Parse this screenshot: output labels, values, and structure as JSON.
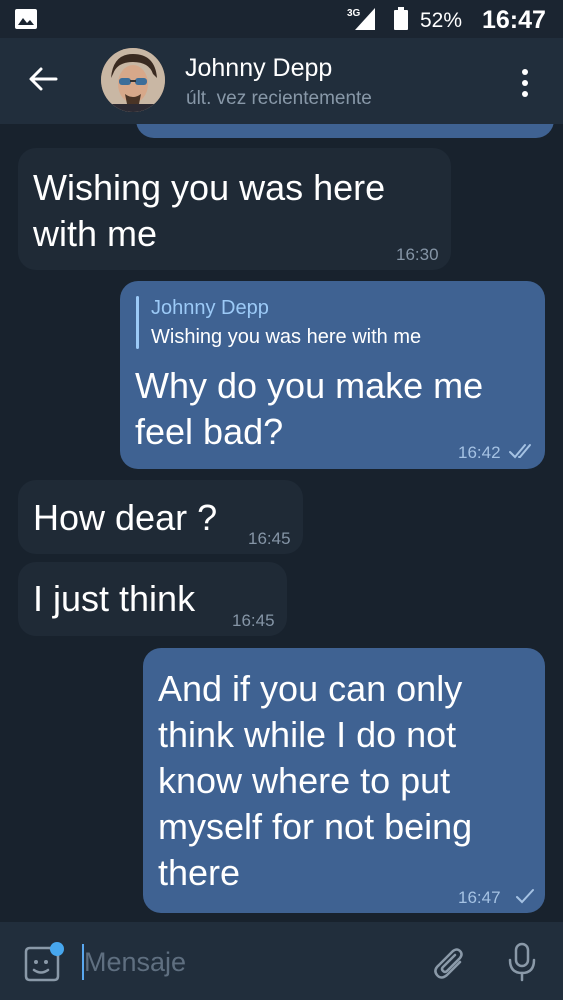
{
  "status_bar": {
    "network": "3G",
    "battery_percent": "52%",
    "time": "16:47"
  },
  "header": {
    "contact_name": "Johnny Depp",
    "last_seen": "últ. vez recientemente"
  },
  "messages": [
    {
      "direction": "incoming",
      "text": "Wishing you was here\nwith me",
      "time": "16:30"
    },
    {
      "direction": "outgoing",
      "reply_to": {
        "name": "Johnny Depp",
        "text": "Wishing you was here with me"
      },
      "text": "Why do you make me\nfeel bad?",
      "time": "16:42",
      "status": "read"
    },
    {
      "direction": "incoming",
      "text": "How dear ?",
      "time": "16:45"
    },
    {
      "direction": "incoming",
      "text": "I just think",
      "time": "16:45"
    },
    {
      "direction": "outgoing",
      "text": "And if you can only\nthink while I do not\nknow where to put\nmyself for not being\nthere",
      "time": "16:47",
      "status": "sent"
    }
  ],
  "input": {
    "placeholder": "Mensaje"
  },
  "colors": {
    "background": "#18222d",
    "incoming_bubble": "#1f2a36",
    "outgoing_bubble": "#3f6292",
    "accent": "#9ccaf7"
  }
}
